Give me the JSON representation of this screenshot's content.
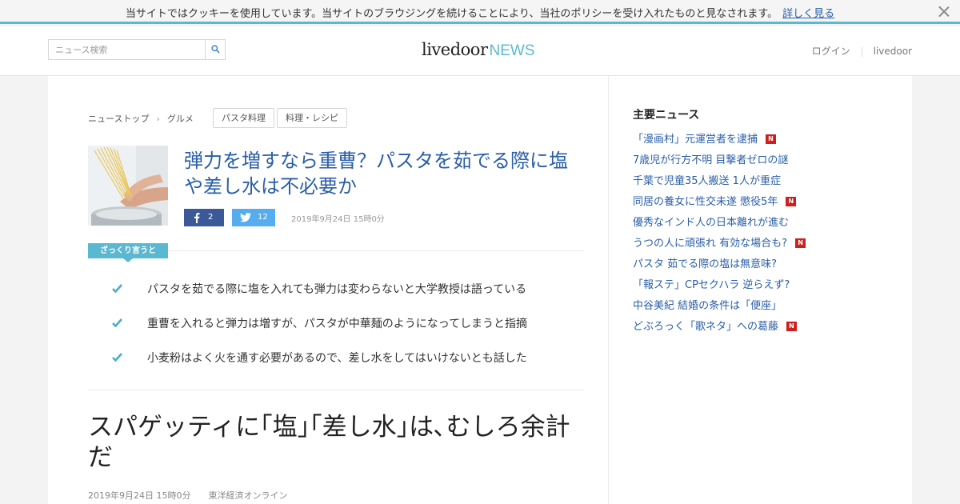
{
  "cookie": {
    "text": "当サイトではクッキーを使用しています。当サイトのブラウジングを続けることにより、当社のポリシーを受け入れたものと見なされます。",
    "link": "詳しく見る"
  },
  "header": {
    "search_placeholder": "ニュース検索",
    "logo_main": "livedoor",
    "logo_sub": "NEWS",
    "login": "ログイン",
    "livedoor_link": "livedoor"
  },
  "breadcrumb": [
    "ニューストップ",
    "グルメ"
  ],
  "breadcrumb_sep": "›",
  "tags": [
    "パスタ料理",
    "料理・レシピ"
  ],
  "article": {
    "headline": "弾力を増すなら重曹？パスタを茹でる際に塩や差し水は不必要か",
    "fb_count": "2",
    "tw_count": "12",
    "date": "2019年9月24日 15時0分",
    "summary_label": "ざっくり言うと",
    "summary": [
      "パスタを茹でる際に塩を入れても弾力は変わらないと大学教授は語っている",
      "重曹を入れると弾力は増すが、パスタが中華麺のようになってしまうと指摘",
      "小麦粉はよく火を通す必要があるので、差し水をしてはいけないとも話した"
    ],
    "title": "スパゲッティに｢塩｣｢差し水｣は､むしろ余計だ",
    "meta_date": "2019年9月24日 15時0分",
    "source": "東洋経済オンライン"
  },
  "sidebar": {
    "title": "主要ニュース",
    "items": [
      {
        "text": "「漫画村」元運営者を逮捕",
        "new": true,
        "new_label": "N"
      },
      {
        "text": "7歳児が行方不明 目撃者ゼロの謎",
        "new": false,
        "new_label": ""
      },
      {
        "text": "千葉で児童35人搬送 1人が重症",
        "new": false,
        "new_label": ""
      },
      {
        "text": "同居の養女に性交未遂 懲役5年",
        "new": true,
        "new_label": "N"
      },
      {
        "text": "優秀なインド人の日本離れが進む",
        "new": false,
        "new_label": ""
      },
      {
        "text": "うつの人に頑張れ 有効な場合も?",
        "new": true,
        "new_label": "N"
      },
      {
        "text": "パスタ 茹でる際の塩は無意味?",
        "new": false,
        "new_label": ""
      },
      {
        "text": "「報ステ」CPセクハラ 逆らえず?",
        "new": false,
        "new_label": ""
      },
      {
        "text": "中谷美紀 結婚の条件は「便座」",
        "new": false,
        "new_label": ""
      },
      {
        "text": "どぶろっく「歌ネタ」への葛藤",
        "new": true,
        "new_label": "N"
      }
    ]
  },
  "colors": {
    "accent": "#5bb8d1",
    "link": "#2a5ea8",
    "facebook": "#3b5998",
    "twitter": "#55acee",
    "new_badge": "#cc1f1f"
  }
}
